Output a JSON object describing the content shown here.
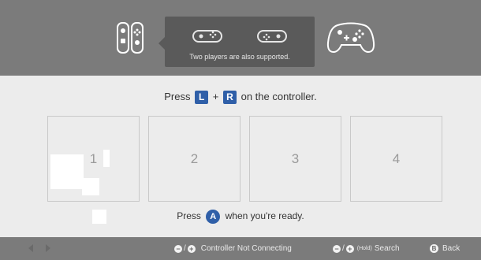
{
  "header": {
    "tooltip_text": "Two players are also supported."
  },
  "instruction": {
    "prefix": "Press",
    "key_l": "L",
    "plus": "+",
    "key_r": "R",
    "suffix": "on the controller."
  },
  "slots": [
    "1",
    "2",
    "3",
    "4"
  ],
  "ready": {
    "prefix": "Press",
    "button": "A",
    "suffix": "when you're ready."
  },
  "footer": {
    "not_connecting": {
      "minus": "−",
      "slash": "/",
      "plus": "+",
      "label": "Controller Not Connecting"
    },
    "search": {
      "minus": "−",
      "slash": "/",
      "plus": "+",
      "hold": "(Hold)",
      "label": "Search"
    },
    "back": {
      "button": "B",
      "label": "Back"
    }
  },
  "icons": {
    "joycon_pair": "joycon-pair-icon",
    "sideways_joycon": "sideways-joycon-icon",
    "pro_controller": "pro-controller-icon",
    "nav_arrows": "nav-arrows-icon"
  },
  "colors": {
    "bar": "#7b7b7b",
    "background": "#ececec",
    "accent_blue": "#2f5fa8",
    "tooltip": "#5a5a5a"
  }
}
